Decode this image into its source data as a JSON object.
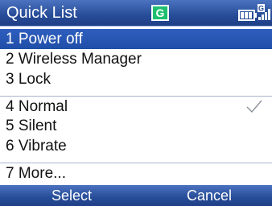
{
  "header": {
    "title": "Quick List",
    "network_badge": "G",
    "status_icons": [
      "battery-icon",
      "signal-icon"
    ],
    "status_badge": "G"
  },
  "menu": {
    "items": [
      {
        "label": "1 Power off",
        "selected": true,
        "checked": false
      },
      {
        "label": "2 Wireless Manager",
        "selected": false,
        "checked": false
      },
      {
        "label": "3 Lock",
        "selected": false,
        "checked": false
      },
      {
        "label": "4 Normal",
        "selected": false,
        "checked": true
      },
      {
        "label": "5 Silent",
        "selected": false,
        "checked": false
      },
      {
        "label": "6 Vibrate",
        "selected": false,
        "checked": false
      },
      {
        "label": "7 More...",
        "selected": false,
        "checked": false
      }
    ]
  },
  "softkeys": {
    "left": "Select",
    "right": "Cancel"
  },
  "colors": {
    "bar": "#274c98",
    "selection": "#2f5fbf",
    "badge": "#1fbf6f"
  }
}
